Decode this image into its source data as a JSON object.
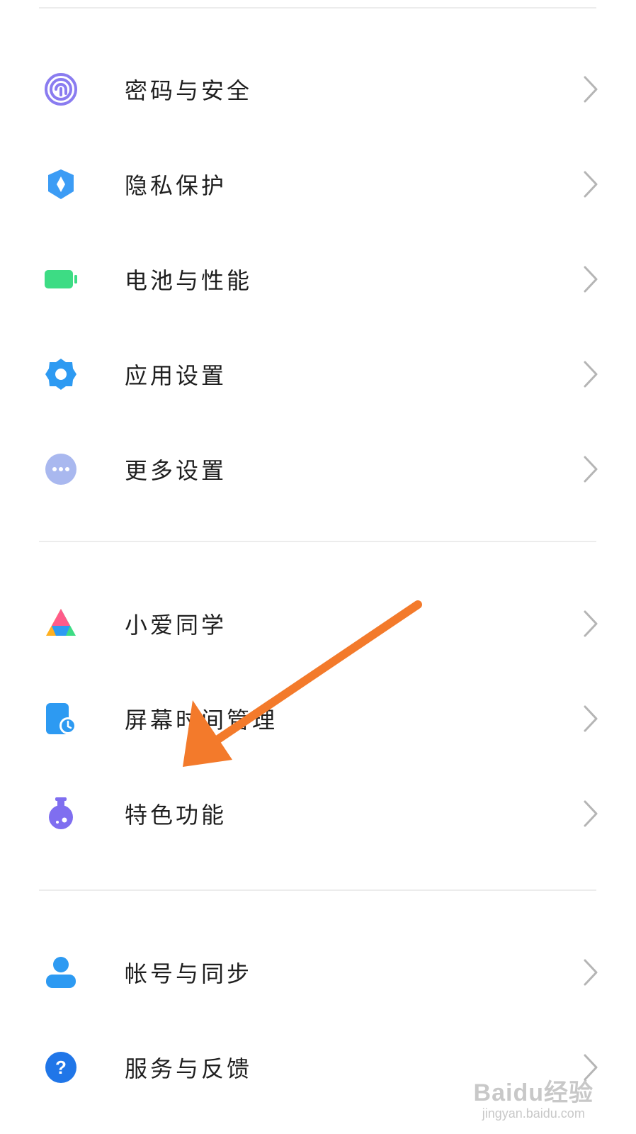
{
  "groups": [
    {
      "items": [
        {
          "label": "密码与安全",
          "icon": "fingerprint-icon",
          "color": "#8a7cf0"
        },
        {
          "label": "隐私保护",
          "icon": "privacy-shield-icon",
          "color": "#3c9cf5"
        },
        {
          "label": "电池与性能",
          "icon": "battery-icon",
          "color": "#3ddc84"
        },
        {
          "label": "应用设置",
          "icon": "gear-icon",
          "color": "#2d9af2"
        },
        {
          "label": "更多设置",
          "icon": "more-dots-icon",
          "color": "#a9b8ef"
        }
      ]
    },
    {
      "items": [
        {
          "label": "小爱同学",
          "icon": "xiaoai-icon",
          "color": "#ff5b8a"
        },
        {
          "label": "屏幕时间管理",
          "icon": "screen-time-icon",
          "color": "#2d9af2"
        },
        {
          "label": "特色功能",
          "icon": "flask-icon",
          "color": "#7f6ef0"
        }
      ]
    },
    {
      "items": [
        {
          "label": "帐号与同步",
          "icon": "account-icon",
          "color": "#2d9af2"
        },
        {
          "label": "服务与反馈",
          "icon": "help-icon",
          "color": "#2076e8"
        }
      ]
    }
  ],
  "annotation": {
    "color": "#f37a2b"
  },
  "watermark": {
    "main": "Baidu经验",
    "sub": "jingyan.baidu.com"
  }
}
